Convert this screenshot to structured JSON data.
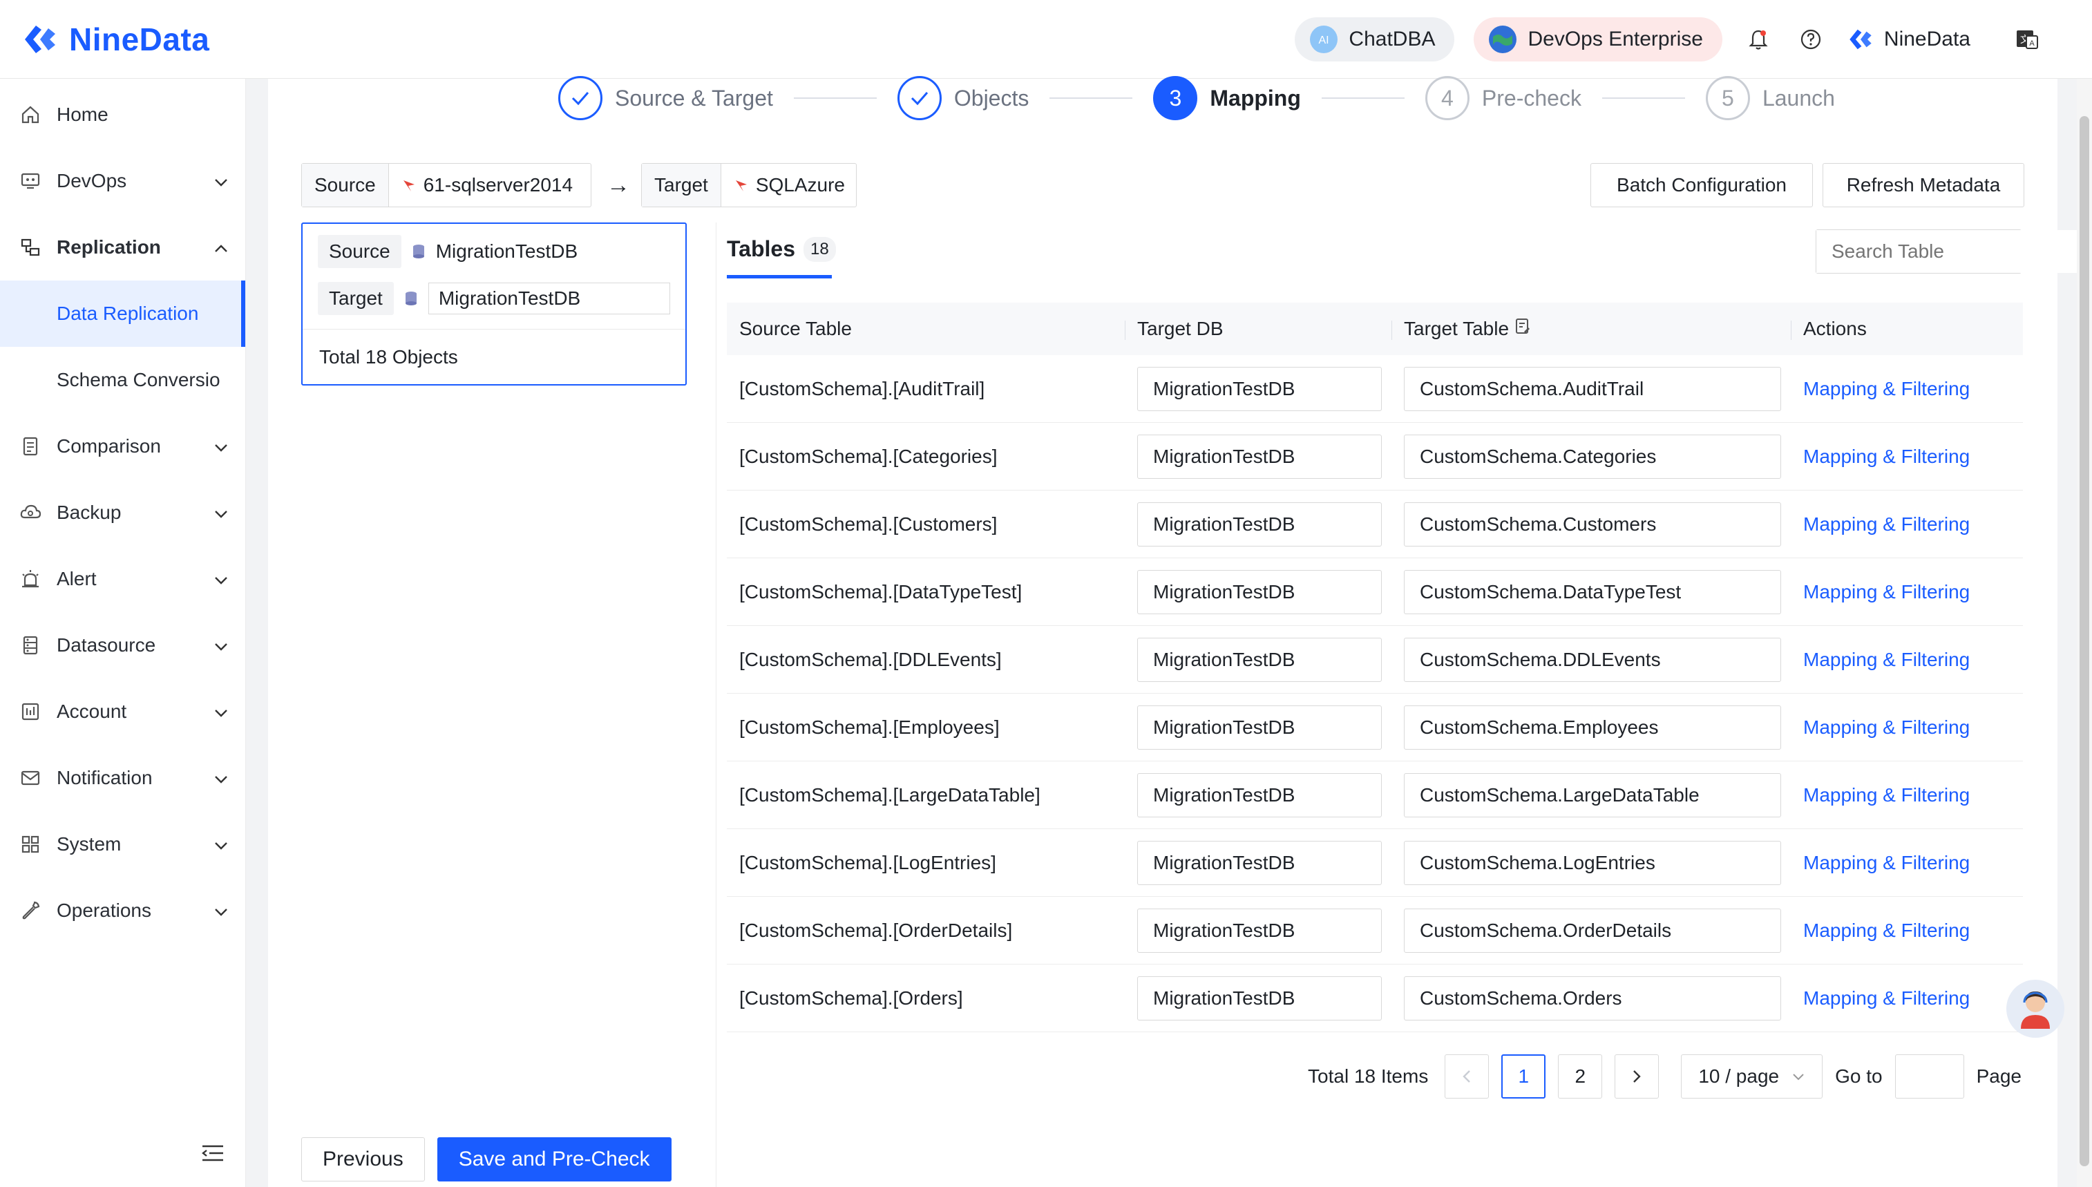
{
  "app": {
    "brand": "NineData"
  },
  "header": {
    "chatdba": "ChatDBA",
    "devops": "DevOps Enterprise",
    "user": "NineData"
  },
  "sidebar": {
    "items": [
      {
        "label": "Home",
        "icon": "home-icon"
      },
      {
        "label": "DevOps",
        "icon": "devops-icon"
      },
      {
        "label": "Replication",
        "icon": "replication-icon"
      },
      {
        "label": "Data Replication"
      },
      {
        "label": "Schema Conversio"
      },
      {
        "label": "Comparison",
        "icon": "comparison-icon"
      },
      {
        "label": "Backup",
        "icon": "backup-icon"
      },
      {
        "label": "Alert",
        "icon": "alert-icon"
      },
      {
        "label": "Datasource",
        "icon": "datasource-icon"
      },
      {
        "label": "Account",
        "icon": "account-icon"
      },
      {
        "label": "Notification",
        "icon": "mail-icon"
      },
      {
        "label": "System",
        "icon": "system-icon"
      },
      {
        "label": "Operations",
        "icon": "wrench-icon"
      }
    ]
  },
  "steps": [
    {
      "num": "1",
      "label": "Source & Target",
      "state": "done"
    },
    {
      "num": "2",
      "label": "Objects",
      "state": "done"
    },
    {
      "num": "3",
      "label": "Mapping",
      "state": "active"
    },
    {
      "num": "4",
      "label": "Pre-check",
      "state": "pending"
    },
    {
      "num": "5",
      "label": "Launch",
      "state": "pending"
    }
  ],
  "connection": {
    "source_key": "Source",
    "source_val": "61-sqlserver2014",
    "target_key": "Target",
    "target_val": "SQLAzure",
    "arrow": "→"
  },
  "buttons": {
    "batch": "Batch Configuration",
    "refresh": "Refresh Metadata",
    "previous": "Previous",
    "save": "Save and Pre-Check"
  },
  "objects_panel": {
    "source_key": "Source",
    "source_db": "MigrationTestDB",
    "target_key": "Target",
    "target_db": "MigrationTestDB",
    "total": "Total 18 Objects"
  },
  "tabs": {
    "label": "Tables",
    "count": "18"
  },
  "search": {
    "placeholder": "Search Table"
  },
  "table": {
    "headers": [
      "Source Table",
      "Target DB",
      "Target Table",
      "Actions"
    ],
    "action_label": "Mapping & Filtering",
    "rows": [
      {
        "source": "[CustomSchema].[AuditTrail]",
        "db": "MigrationTestDB",
        "target": "CustomSchema.AuditTrail"
      },
      {
        "source": "[CustomSchema].[Categories]",
        "db": "MigrationTestDB",
        "target": "CustomSchema.Categories"
      },
      {
        "source": "[CustomSchema].[Customers]",
        "db": "MigrationTestDB",
        "target": "CustomSchema.Customers"
      },
      {
        "source": "[CustomSchema].[DataTypeTest]",
        "db": "MigrationTestDB",
        "target": "CustomSchema.DataTypeTest"
      },
      {
        "source": "[CustomSchema].[DDLEvents]",
        "db": "MigrationTestDB",
        "target": "CustomSchema.DDLEvents"
      },
      {
        "source": "[CustomSchema].[Employees]",
        "db": "MigrationTestDB",
        "target": "CustomSchema.Employees"
      },
      {
        "source": "[CustomSchema].[LargeDataTable]",
        "db": "MigrationTestDB",
        "target": "CustomSchema.LargeDataTable"
      },
      {
        "source": "[CustomSchema].[LogEntries]",
        "db": "MigrationTestDB",
        "target": "CustomSchema.LogEntries"
      },
      {
        "source": "[CustomSchema].[OrderDetails]",
        "db": "MigrationTestDB",
        "target": "CustomSchema.OrderDetails"
      },
      {
        "source": "[CustomSchema].[Orders]",
        "db": "MigrationTestDB",
        "target": "CustomSchema.Orders"
      }
    ]
  },
  "pagination": {
    "total": "Total 18 Items",
    "pages": [
      "1",
      "2"
    ],
    "page_size": "10 / page",
    "goto": "Go to",
    "page": "Page"
  },
  "colors": {
    "accent": "#1a5cff",
    "active_bg": "#e8f0ff"
  }
}
